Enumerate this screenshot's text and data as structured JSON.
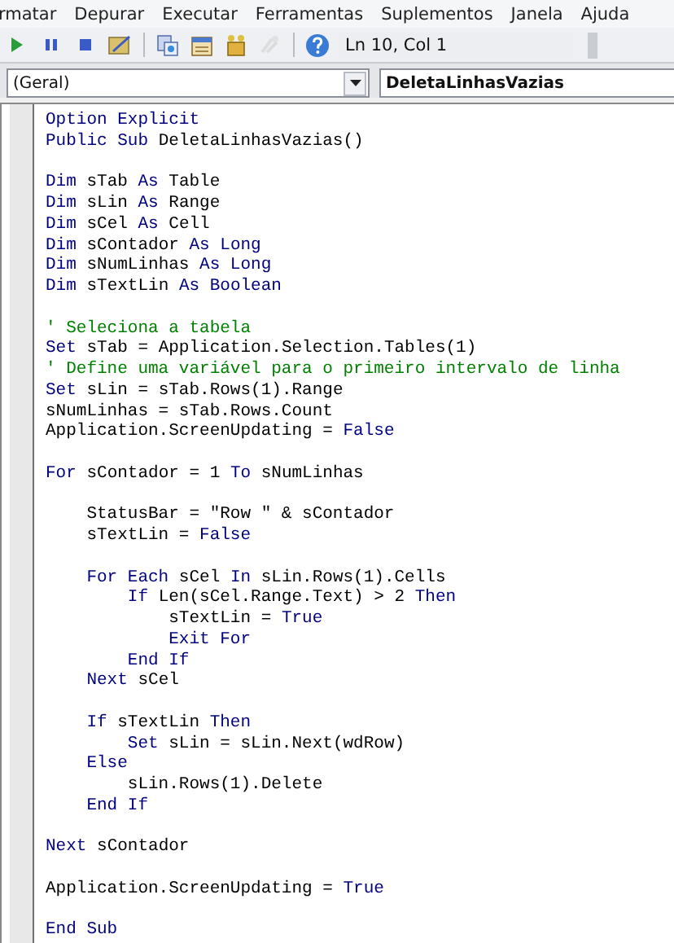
{
  "menu": [
    "rmatar",
    "Depurar",
    "Executar",
    "Ferramentas",
    "Suplementos",
    "Janela",
    "Ajuda"
  ],
  "toolbar": {
    "buttons": [
      {
        "kind": "run",
        "disabled": false
      },
      {
        "kind": "pause",
        "disabled": false
      },
      {
        "kind": "stop",
        "disabled": false
      },
      {
        "kind": "design",
        "disabled": false
      },
      {
        "kind": "sep"
      },
      {
        "kind": "explorer",
        "disabled": false
      },
      {
        "kind": "properties",
        "disabled": false
      },
      {
        "kind": "browser",
        "disabled": false
      },
      {
        "kind": "toolbox",
        "disabled": true
      },
      {
        "kind": "sep"
      },
      {
        "kind": "help",
        "disabled": false
      }
    ],
    "position": "Ln 10, Col 1"
  },
  "object_combo": "(Geral)",
  "procedure_combo": "DeletaLinhasVazias",
  "code_lines": [
    {
      "kind": "code",
      "segments": [
        {
          "kind": "keyword",
          "text": "Option Explicit"
        }
      ]
    },
    {
      "kind": "code",
      "segments": [
        {
          "kind": "keyword",
          "text": "Public Sub "
        },
        {
          "kind": "plain",
          "text": "DeletaLinhasVazias()"
        }
      ]
    },
    {
      "kind": "blank"
    },
    {
      "kind": "code",
      "segments": [
        {
          "kind": "keyword",
          "text": "Dim "
        },
        {
          "kind": "plain",
          "text": "sTab "
        },
        {
          "kind": "keyword",
          "text": "As "
        },
        {
          "kind": "plain",
          "text": "Table"
        }
      ]
    },
    {
      "kind": "code",
      "segments": [
        {
          "kind": "keyword",
          "text": "Dim "
        },
        {
          "kind": "plain",
          "text": "sLin "
        },
        {
          "kind": "keyword",
          "text": "As "
        },
        {
          "kind": "plain",
          "text": "Range"
        }
      ]
    },
    {
      "kind": "code",
      "segments": [
        {
          "kind": "keyword",
          "text": "Dim "
        },
        {
          "kind": "plain",
          "text": "sCel "
        },
        {
          "kind": "keyword",
          "text": "As "
        },
        {
          "kind": "plain",
          "text": "Cell"
        }
      ]
    },
    {
      "kind": "code",
      "segments": [
        {
          "kind": "keyword",
          "text": "Dim "
        },
        {
          "kind": "plain",
          "text": "sContador "
        },
        {
          "kind": "keyword",
          "text": "As Long"
        }
      ]
    },
    {
      "kind": "code",
      "segments": [
        {
          "kind": "keyword",
          "text": "Dim "
        },
        {
          "kind": "plain",
          "text": "sNumLinhas "
        },
        {
          "kind": "keyword",
          "text": "As Long"
        }
      ]
    },
    {
      "kind": "code",
      "segments": [
        {
          "kind": "keyword",
          "text": "Dim "
        },
        {
          "kind": "plain",
          "text": "sTextLin "
        },
        {
          "kind": "keyword",
          "text": "As Boolean"
        }
      ]
    },
    {
      "kind": "blank"
    },
    {
      "kind": "code",
      "segments": [
        {
          "kind": "comment",
          "text": "' Seleciona a tabela"
        }
      ]
    },
    {
      "kind": "code",
      "segments": [
        {
          "kind": "keyword",
          "text": "Set "
        },
        {
          "kind": "plain",
          "text": "sTab = Application.Selection.Tables(1)"
        }
      ]
    },
    {
      "kind": "code",
      "segments": [
        {
          "kind": "comment",
          "text": "' Define uma variável para o primeiro intervalo de linha"
        }
      ]
    },
    {
      "kind": "code",
      "segments": [
        {
          "kind": "keyword",
          "text": "Set "
        },
        {
          "kind": "plain",
          "text": "sLin = sTab.Rows(1).Range"
        }
      ]
    },
    {
      "kind": "code",
      "segments": [
        {
          "kind": "plain",
          "text": "sNumLinhas = sTab.Rows.Count"
        }
      ]
    },
    {
      "kind": "code",
      "segments": [
        {
          "kind": "plain",
          "text": "Application.ScreenUpdating = "
        },
        {
          "kind": "keyword",
          "text": "False"
        }
      ]
    },
    {
      "kind": "blank"
    },
    {
      "kind": "code",
      "segments": [
        {
          "kind": "keyword",
          "text": "For "
        },
        {
          "kind": "plain",
          "text": "sContador = 1 "
        },
        {
          "kind": "keyword",
          "text": "To "
        },
        {
          "kind": "plain",
          "text": "sNumLinhas"
        }
      ]
    },
    {
      "kind": "blank"
    },
    {
      "kind": "code",
      "segments": [
        {
          "kind": "plain",
          "text": "    StatusBar = \"Row \" & sContador"
        }
      ]
    },
    {
      "kind": "code",
      "segments": [
        {
          "kind": "plain",
          "text": "    sTextLin = "
        },
        {
          "kind": "keyword",
          "text": "False"
        }
      ]
    },
    {
      "kind": "blank"
    },
    {
      "kind": "code",
      "segments": [
        {
          "kind": "keyword",
          "text": "    For Each "
        },
        {
          "kind": "plain",
          "text": "sCel "
        },
        {
          "kind": "keyword",
          "text": "In "
        },
        {
          "kind": "plain",
          "text": "sLin.Rows(1).Cells"
        }
      ]
    },
    {
      "kind": "code",
      "segments": [
        {
          "kind": "keyword",
          "text": "        If "
        },
        {
          "kind": "plain",
          "text": "Len(sCel.Range.Text) > 2 "
        },
        {
          "kind": "keyword",
          "text": "Then"
        }
      ]
    },
    {
      "kind": "code",
      "segments": [
        {
          "kind": "plain",
          "text": "            sTextLin = "
        },
        {
          "kind": "keyword",
          "text": "True"
        }
      ]
    },
    {
      "kind": "code",
      "segments": [
        {
          "kind": "keyword",
          "text": "            Exit For"
        }
      ]
    },
    {
      "kind": "code",
      "segments": [
        {
          "kind": "keyword",
          "text": "        End If"
        }
      ]
    },
    {
      "kind": "code",
      "segments": [
        {
          "kind": "keyword",
          "text": "    Next "
        },
        {
          "kind": "plain",
          "text": "sCel"
        }
      ]
    },
    {
      "kind": "blank"
    },
    {
      "kind": "code",
      "segments": [
        {
          "kind": "keyword",
          "text": "    If "
        },
        {
          "kind": "plain",
          "text": "sTextLin "
        },
        {
          "kind": "keyword",
          "text": "Then"
        }
      ]
    },
    {
      "kind": "code",
      "segments": [
        {
          "kind": "keyword",
          "text": "        Set "
        },
        {
          "kind": "plain",
          "text": "sLin = sLin.Next(wdRow)"
        }
      ]
    },
    {
      "kind": "code",
      "segments": [
        {
          "kind": "keyword",
          "text": "    Else"
        }
      ]
    },
    {
      "kind": "code",
      "segments": [
        {
          "kind": "plain",
          "text": "        sLin.Rows(1).Delete"
        }
      ]
    },
    {
      "kind": "code",
      "segments": [
        {
          "kind": "keyword",
          "text": "    End If"
        }
      ]
    },
    {
      "kind": "blank"
    },
    {
      "kind": "code",
      "segments": [
        {
          "kind": "keyword",
          "text": "Next "
        },
        {
          "kind": "plain",
          "text": "sContador"
        }
      ]
    },
    {
      "kind": "blank"
    },
    {
      "kind": "code",
      "segments": [
        {
          "kind": "plain",
          "text": "Application.ScreenUpdating = "
        },
        {
          "kind": "keyword",
          "text": "True"
        }
      ]
    },
    {
      "kind": "blank"
    },
    {
      "kind": "code",
      "segments": [
        {
          "kind": "keyword",
          "text": "End Sub"
        }
      ]
    }
  ]
}
